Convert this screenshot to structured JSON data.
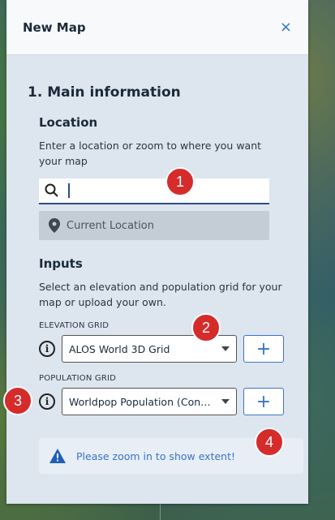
{
  "header": {
    "title": "New Map",
    "close_label": "×"
  },
  "section": {
    "title": "1. Main information"
  },
  "location": {
    "title": "Location",
    "description": "Enter a location or zoom to where you want your map",
    "search_value": "",
    "current_location": "Current Location"
  },
  "inputs": {
    "title": "Inputs",
    "description": "Select an elevation and population grid for your map or upload your own.",
    "elevation_label": "ELEVATION GRID",
    "elevation_value": "ALOS World 3D Grid",
    "population_label": "POPULATION GRID",
    "population_value": "Worldpop Population (Constrained)",
    "add_label": "+"
  },
  "notice": {
    "text": "Please zoom in to show extent!"
  },
  "badges": [
    "1",
    "2",
    "3",
    "4"
  ],
  "colors": {
    "accent": "#3a73c8",
    "badge": "#d62b2b",
    "panel": "#dde5ee"
  }
}
